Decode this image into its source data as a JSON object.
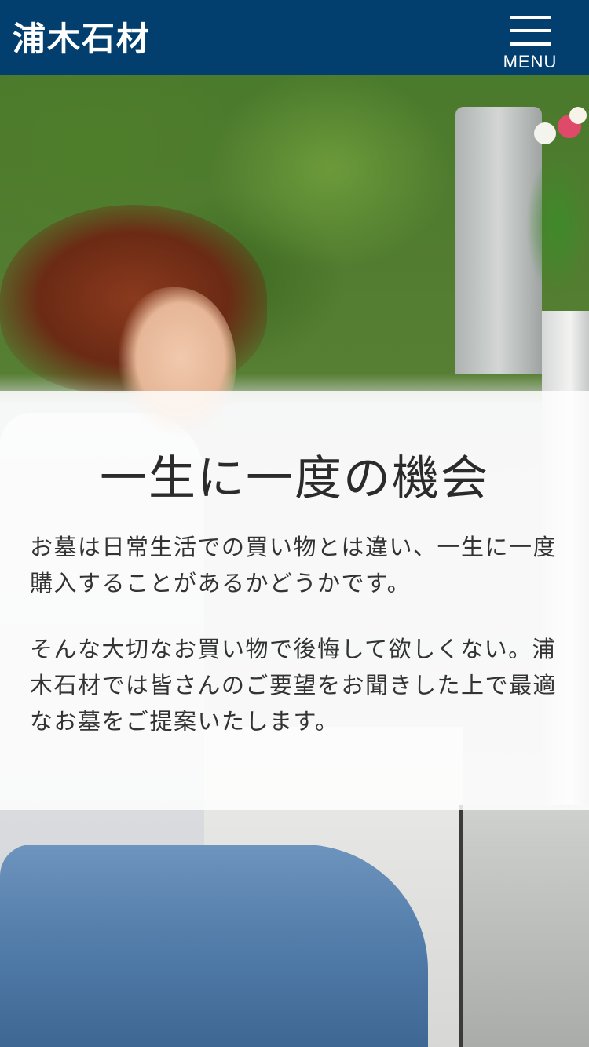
{
  "header": {
    "logo": "浦木石材",
    "menu_label": "MENU"
  },
  "hero": {
    "photo_description_icon": "praying-woman-at-grave-photo"
  },
  "intro": {
    "headline": "一生に一度の機会",
    "paragraph1": "お墓は日常生活での買い物とは違い、一生に一度購入することがあるかどうかです。",
    "paragraph2": "そんな大切なお買い物で後悔して欲しくない。浦木石材では皆さんのご要望をお聞きした上で最適なお墓をご提案いたします。"
  },
  "colors": {
    "header_bg": "#033f6e",
    "text": "#333333",
    "overlay": "rgba(255,255,255,0.84)"
  }
}
